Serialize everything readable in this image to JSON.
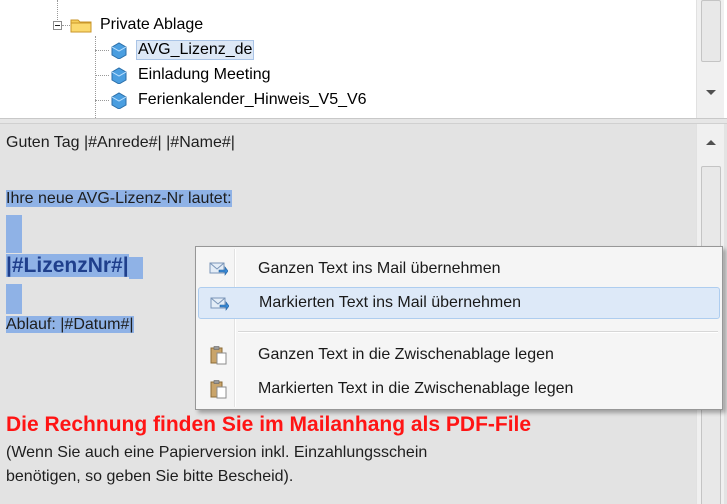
{
  "tree": {
    "folder_label": "Private Ablage",
    "items": [
      {
        "label": "AVG_Lizenz_de",
        "selected": true
      },
      {
        "label": "Einladung Meeting",
        "selected": false
      },
      {
        "label": "Ferienkalender_Hinweis_V5_V6",
        "selected": false
      }
    ]
  },
  "text": {
    "greeting": "Guten Tag |#Anrede#| |#Name#|",
    "license_intro": "Ihre neue AVG-Lizenz-Nr lautet:",
    "license_placeholder": "|#LizenzNr#|",
    "expiry_label": "Ablauf: ",
    "expiry_value": "|#Datum#|",
    "invoice_notice": "Die Rechnung finden Sie im Mailanhang als PDF-File",
    "paper_note_line1": "(Wenn Sie auch eine Papierversion inkl. Einzahlungsschein",
    "paper_note_line2": "benötigen, so geben Sie bitte Bescheid)."
  },
  "context_menu": {
    "items": [
      {
        "label": "Ganzen Text ins Mail übernehmen",
        "icon": "mail-insert-icon"
      },
      {
        "label": "Markierten Text ins Mail übernehmen",
        "icon": "mail-insert-icon",
        "highlighted": true
      },
      {
        "label": "Ganzen Text in die Zwischenablage legen",
        "icon": "clipboard-paste-icon"
      },
      {
        "label": "Markierten Text in die Zwischenablage legen",
        "icon": "clipboard-paste-icon"
      }
    ]
  },
  "colors": {
    "selection": "#8fb2e6",
    "license_text": "#1f3f8c",
    "notice_red": "#ff1414",
    "menu_highlight": "#dde9f8"
  }
}
